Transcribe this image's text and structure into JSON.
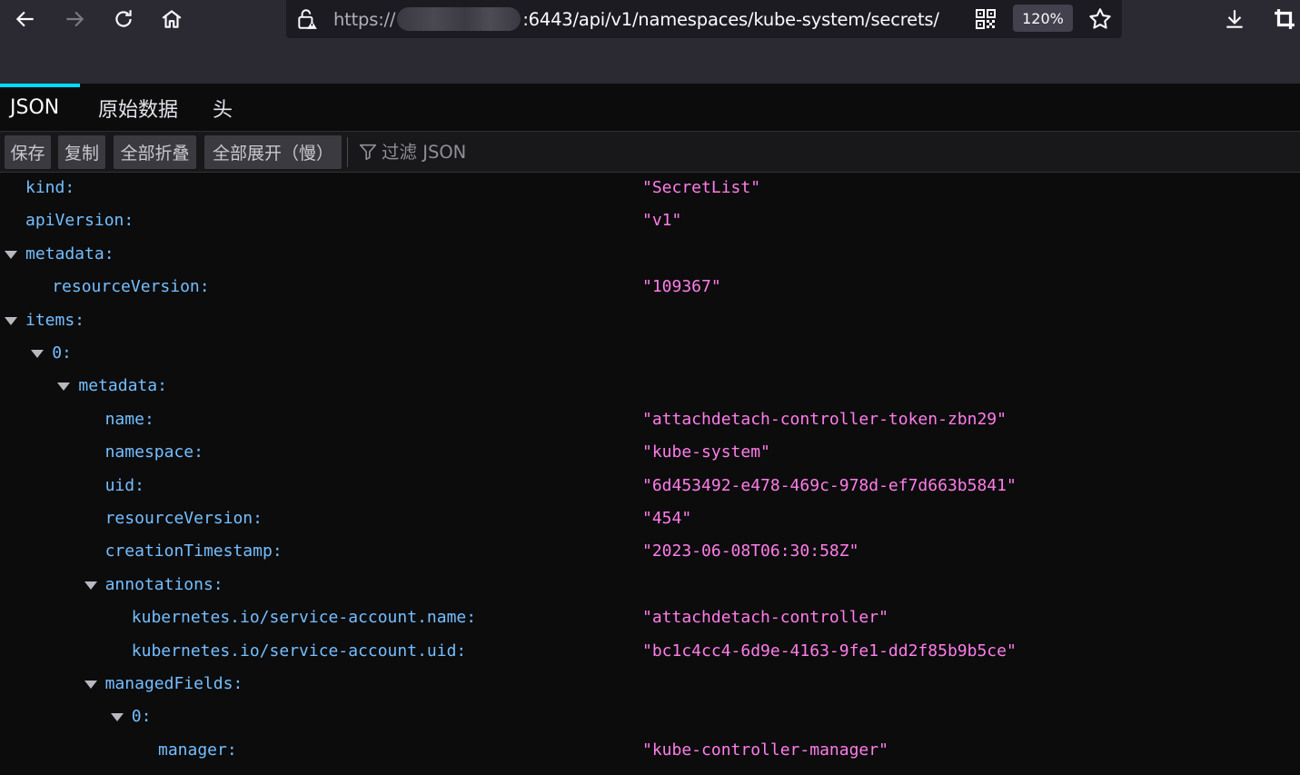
{
  "browser": {
    "url_scheme": "https://",
    "url_rest": ":6443/api/v1/namespaces/kube-system/secrets/",
    "zoom": "120%"
  },
  "tabs": [
    {
      "label": "JSON",
      "active": true
    },
    {
      "label": "原始数据",
      "active": false
    },
    {
      "label": "头",
      "active": false
    }
  ],
  "toolbar": {
    "save": "保存",
    "copy": "复制",
    "collapse_all": "全部折叠",
    "expand_all": "全部展开（慢）",
    "filter_placeholder": "过滤 JSON"
  },
  "tree": [
    {
      "key": "kind:",
      "value": "\"SecretList\"",
      "depth": 0,
      "toggle": false
    },
    {
      "key": "apiVersion:",
      "value": "\"v1\"",
      "depth": 0,
      "toggle": false
    },
    {
      "key": "metadata:",
      "value": "",
      "depth": 0,
      "toggle": true
    },
    {
      "key": "resourceVersion:",
      "value": "\"109367\"",
      "depth": 1,
      "toggle": false
    },
    {
      "key": "items:",
      "value": "",
      "depth": 0,
      "toggle": true
    },
    {
      "key": "0:",
      "value": "",
      "depth": 1,
      "toggle": true
    },
    {
      "key": "metadata:",
      "value": "",
      "depth": 2,
      "toggle": true
    },
    {
      "key": "name:",
      "value": "\"attachdetach-controller-token-zbn29\"",
      "depth": 3,
      "toggle": false
    },
    {
      "key": "namespace:",
      "value": "\"kube-system\"",
      "depth": 3,
      "toggle": false
    },
    {
      "key": "uid:",
      "value": "\"6d453492-e478-469c-978d-ef7d663b5841\"",
      "depth": 3,
      "toggle": false
    },
    {
      "key": "resourceVersion:",
      "value": "\"454\"",
      "depth": 3,
      "toggle": false
    },
    {
      "key": "creationTimestamp:",
      "value": "\"2023-06-08T06:30:58Z\"",
      "depth": 3,
      "toggle": false
    },
    {
      "key": "annotations:",
      "value": "",
      "depth": 3,
      "toggle": true
    },
    {
      "key": "kubernetes.io/service-account.name:",
      "value": "\"attachdetach-controller\"",
      "depth": 4,
      "toggle": false
    },
    {
      "key": "kubernetes.io/service-account.uid:",
      "value": "\"bc1c4cc4-6d9e-4163-9fe1-dd2f85b9b5ce\"",
      "depth": 4,
      "toggle": false
    },
    {
      "key": "managedFields:",
      "value": "",
      "depth": 3,
      "toggle": true
    },
    {
      "key": "0:",
      "value": "",
      "depth": 4,
      "toggle": true
    },
    {
      "key": "manager:",
      "value": "\"kube-controller-manager\"",
      "depth": 5,
      "toggle": false
    }
  ]
}
